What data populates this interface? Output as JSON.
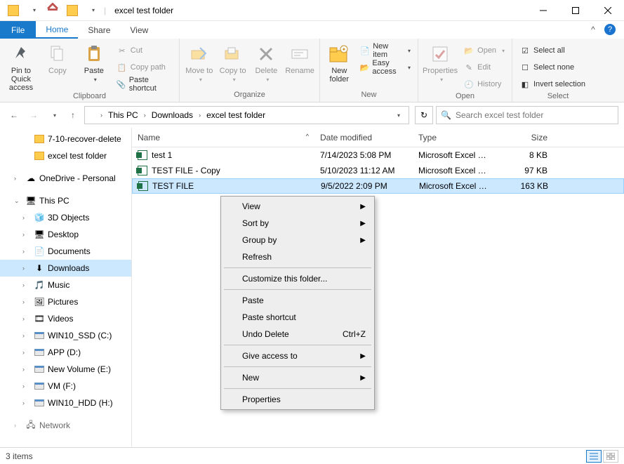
{
  "title": "excel test folder",
  "tabs": {
    "file": "File",
    "home": "Home",
    "share": "Share",
    "view": "View"
  },
  "ribbon": {
    "clipboard": {
      "label": "Clipboard",
      "pin": "Pin to Quick access",
      "copy": "Copy",
      "paste": "Paste",
      "cut": "Cut",
      "copypath": "Copy path",
      "pasteshortcut": "Paste shortcut"
    },
    "organize": {
      "label": "Organize",
      "moveto": "Move to",
      "copyto": "Copy to",
      "delete": "Delete",
      "rename": "Rename"
    },
    "new": {
      "label": "New",
      "newfolder": "New folder",
      "newitem": "New item",
      "easyaccess": "Easy access"
    },
    "open": {
      "label": "Open",
      "properties": "Properties",
      "open": "Open",
      "edit": "Edit",
      "history": "History"
    },
    "select": {
      "label": "Select",
      "selectall": "Select all",
      "selectnone": "Select none",
      "invert": "Invert selection"
    }
  },
  "breadcrumbs": [
    "This PC",
    "Downloads",
    "excel test folder"
  ],
  "search_placeholder": "Search excel test folder",
  "tree": {
    "qa1": "7-10-recover-delete",
    "qa2": "excel test folder",
    "onedrive": "OneDrive - Personal",
    "thispc": "This PC",
    "s1": "3D Objects",
    "s2": "Desktop",
    "s3": "Documents",
    "s4": "Downloads",
    "s5": "Music",
    "s6": "Pictures",
    "s7": "Videos",
    "d1": "WIN10_SSD (C:)",
    "d2": "APP (D:)",
    "d3": "New Volume (E:)",
    "d4": "VM (F:)",
    "d5": "WIN10_HDD (H:)",
    "network": "Network"
  },
  "columns": {
    "name": "Name",
    "date": "Date modified",
    "type": "Type",
    "size": "Size"
  },
  "files": [
    {
      "name": "test 1",
      "date": "7/14/2023 5:08 PM",
      "type": "Microsoft Excel W...",
      "size": "8 KB"
    },
    {
      "name": "TEST FILE - Copy",
      "date": "5/10/2023 11:12 AM",
      "type": "Microsoft Excel W...",
      "size": "97 KB"
    },
    {
      "name": "TEST FILE",
      "date": "9/5/2022 2:09 PM",
      "type": "Microsoft Excel W...",
      "size": "163 KB"
    }
  ],
  "context": {
    "view": "View",
    "sortby": "Sort by",
    "groupby": "Group by",
    "refresh": "Refresh",
    "customize": "Customize this folder...",
    "paste": "Paste",
    "pasteshortcut": "Paste shortcut",
    "undodelete": "Undo Delete",
    "undodelete_key": "Ctrl+Z",
    "giveaccess": "Give access to",
    "new": "New",
    "properties": "Properties"
  },
  "status": "3 items"
}
